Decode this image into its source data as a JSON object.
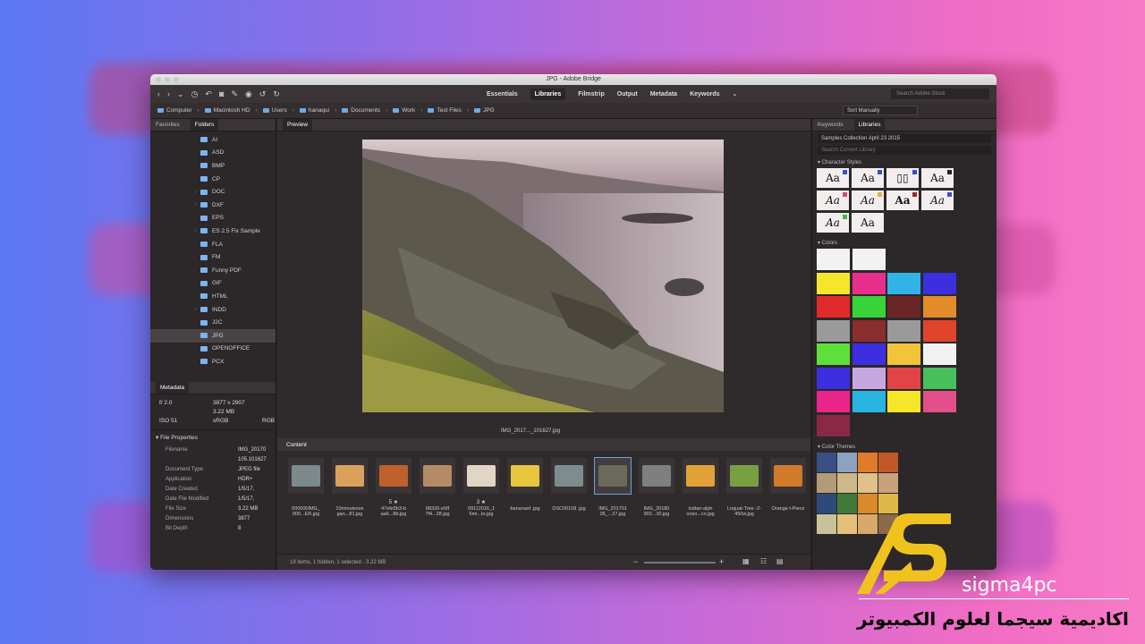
{
  "window": {
    "title": "JPG - Adobe Bridge"
  },
  "workspace_tabs": [
    "Essentials",
    "Libraries",
    "Filmstrip",
    "Output",
    "Metadata",
    "Keywords"
  ],
  "search_stock_placeholder": "Search Adobe Stock",
  "breadcrumbs": [
    "Computer",
    "Macintosh HD",
    "Users",
    "hanaqui",
    "Documents",
    "Work",
    "Test Files",
    "JPG"
  ],
  "sort_label": "Sort Manually",
  "left_tabs": [
    "Favorites",
    "Folders"
  ],
  "folders": [
    {
      "name": "AI",
      "arrow": false
    },
    {
      "name": "ASD",
      "arrow": false
    },
    {
      "name": "BMP",
      "arrow": false
    },
    {
      "name": "CP",
      "arrow": false
    },
    {
      "name": "DOC",
      "arrow": true
    },
    {
      "name": "DXF",
      "arrow": true
    },
    {
      "name": "EPS",
      "arrow": false
    },
    {
      "name": "ES 2.5 Fix Sample",
      "arrow": true
    },
    {
      "name": "FLA",
      "arrow": false
    },
    {
      "name": "FM",
      "arrow": false
    },
    {
      "name": "Funny PDF",
      "arrow": false
    },
    {
      "name": "GIF",
      "arrow": false
    },
    {
      "name": "HTML",
      "arrow": false
    },
    {
      "name": "INDD",
      "arrow": true
    },
    {
      "name": "J2C",
      "arrow": false
    },
    {
      "name": "JPG",
      "arrow": false,
      "selected": true
    },
    {
      "name": "OPENOFFICE",
      "arrow": false
    },
    {
      "name": "PCX",
      "arrow": false
    }
  ],
  "metadata": {
    "tab": "Metadata",
    "grid": [
      "f/ 2.0",
      "3877 x 2907",
      "",
      "",
      "3.22 MB",
      "",
      "ISO 51",
      "sRGB",
      "RGB"
    ]
  },
  "file_properties": {
    "title": "File Properties",
    "rows": [
      {
        "k": "Filename",
        "v": "IMG_20170"
      },
      {
        "k": "",
        "v": "105.101627"
      },
      {
        "k": "Document Type",
        "v": "JPEG file"
      },
      {
        "k": "Application",
        "v": "HDR+"
      },
      {
        "k": "Date Created",
        "v": "1/5/17,"
      },
      {
        "k": "Date File Modified",
        "v": "1/5/17,"
      },
      {
        "k": "File Size",
        "v": "3.22 MB"
      },
      {
        "k": "Dimensions",
        "v": "3877"
      },
      {
        "k": "Bit Depth",
        "v": "8"
      }
    ]
  },
  "preview": {
    "tab": "Preview",
    "caption": "IMG_2017..._101627.jpg"
  },
  "content": {
    "tab": "Content",
    "thumbs": [
      {
        "label": "000000IMG_ 000...ER.jpg",
        "stars": "",
        "color": "#7c8a8c"
      },
      {
        "label": "10minutesve gan...81.jpg",
        "stars": "",
        "color": "#d9a15c"
      },
      {
        "label": "47efe5b3-b aa6...8b.jpg",
        "stars": "5 ★",
        "color": "#c0602c"
      },
      {
        "label": "88326-e5ff 7f4...28.jpg",
        "stars": "",
        "color": "#b58b66"
      },
      {
        "label": "09112016_1 5mi...to.jpg",
        "stars": "3 ★",
        "color": "#e1d6c4"
      },
      {
        "label": "bananasf .jpg",
        "stars": "",
        "color": "#e8c53a"
      },
      {
        "label": "DSC00108 .jpg",
        "stars": "",
        "color": "#7f8c8e"
      },
      {
        "label": "IMG_201701 05_...27.jpg",
        "stars": "",
        "color": "#6c6a5a",
        "selected": true
      },
      {
        "label": "IMG_20180 902...30.jpg",
        "stars": "",
        "color": "#7d7f80"
      },
      {
        "label": "indian-alph onso...co.jpg",
        "stars": "",
        "color": "#e2a238"
      },
      {
        "label": "Loquat-Tree -2-450w.jpg",
        "stars": "",
        "color": "#78a043"
      },
      {
        "label": "Orange t-Piece",
        "stars": "",
        "color": "#d07a2a"
      }
    ],
    "status": "19 items, 1 hidden, 1 selected - 3.22 MB"
  },
  "right_tabs": [
    "Keywords",
    "Libraries"
  ],
  "library_select": "Samples Collection April 23 2015",
  "library_search": "Search Current Library",
  "character_styles": {
    "title": "Character Styles",
    "items": [
      {
        "text": "Aa",
        "tag": "#3a4fd0"
      },
      {
        "text": "Aa",
        "tag": "#3a4fd0"
      },
      {
        "text": "▯▯",
        "tag": "#3a4fd0"
      },
      {
        "text": "Aa",
        "tag": "#222222"
      },
      {
        "text": "Aa",
        "tag": "#d34a8a"
      },
      {
        "text": "Aa",
        "tag": "#d8b54a"
      },
      {
        "text": "Aa",
        "tag": "#9a2b2b"
      },
      {
        "text": "Aa",
        "tag": "#3a4fd0"
      },
      {
        "text": "Aa",
        "tag": "#44b644"
      },
      {
        "text": "Aa",
        "tag": ""
      }
    ]
  },
  "colors": {
    "title": "Colors",
    "swatches": [
      "#f2f2f2",
      "#f2f2f2",
      "#2a2728",
      "#2a2728",
      "#f5e62a",
      "#e92f8c",
      "#32b3e8",
      "#3b2fe0",
      "#e02a2a",
      "#3ad43a",
      "#6a2626",
      "#e38b2a",
      "#9a9a9a",
      "#8a2d2d",
      "#9a9a9a",
      "#e0442a",
      "#5ee03a",
      "#3d2ee0",
      "#f2c43a",
      "#f2f2f2",
      "#3d2ee0",
      "#c8a6e0",
      "#e04444",
      "#46c05a",
      "#e9258c",
      "#2ab4e0",
      "#f5e62a",
      "#e04f8a",
      "#8a2848"
    ]
  },
  "color_themes": {
    "title": "Color Themes",
    "rows": [
      [
        "#3a4f86",
        "#8ca3c0",
        "#e07b2a",
        "#c2582a"
      ],
      [
        "#b39b78",
        "#cdb88a",
        "#e2c08a",
        "#c7a27a"
      ],
      [
        "#2f4a7a",
        "#3f7a3a",
        "#d98a2a",
        "#e0b84a"
      ],
      [
        "#c9c299",
        "#e5c07a",
        "#d8a96a",
        "#8b6a4a"
      ]
    ]
  },
  "brand": {
    "name": "sigma4pc",
    "arabic": "اكاديمية سيجما لعلوم الكمبيوتر"
  }
}
